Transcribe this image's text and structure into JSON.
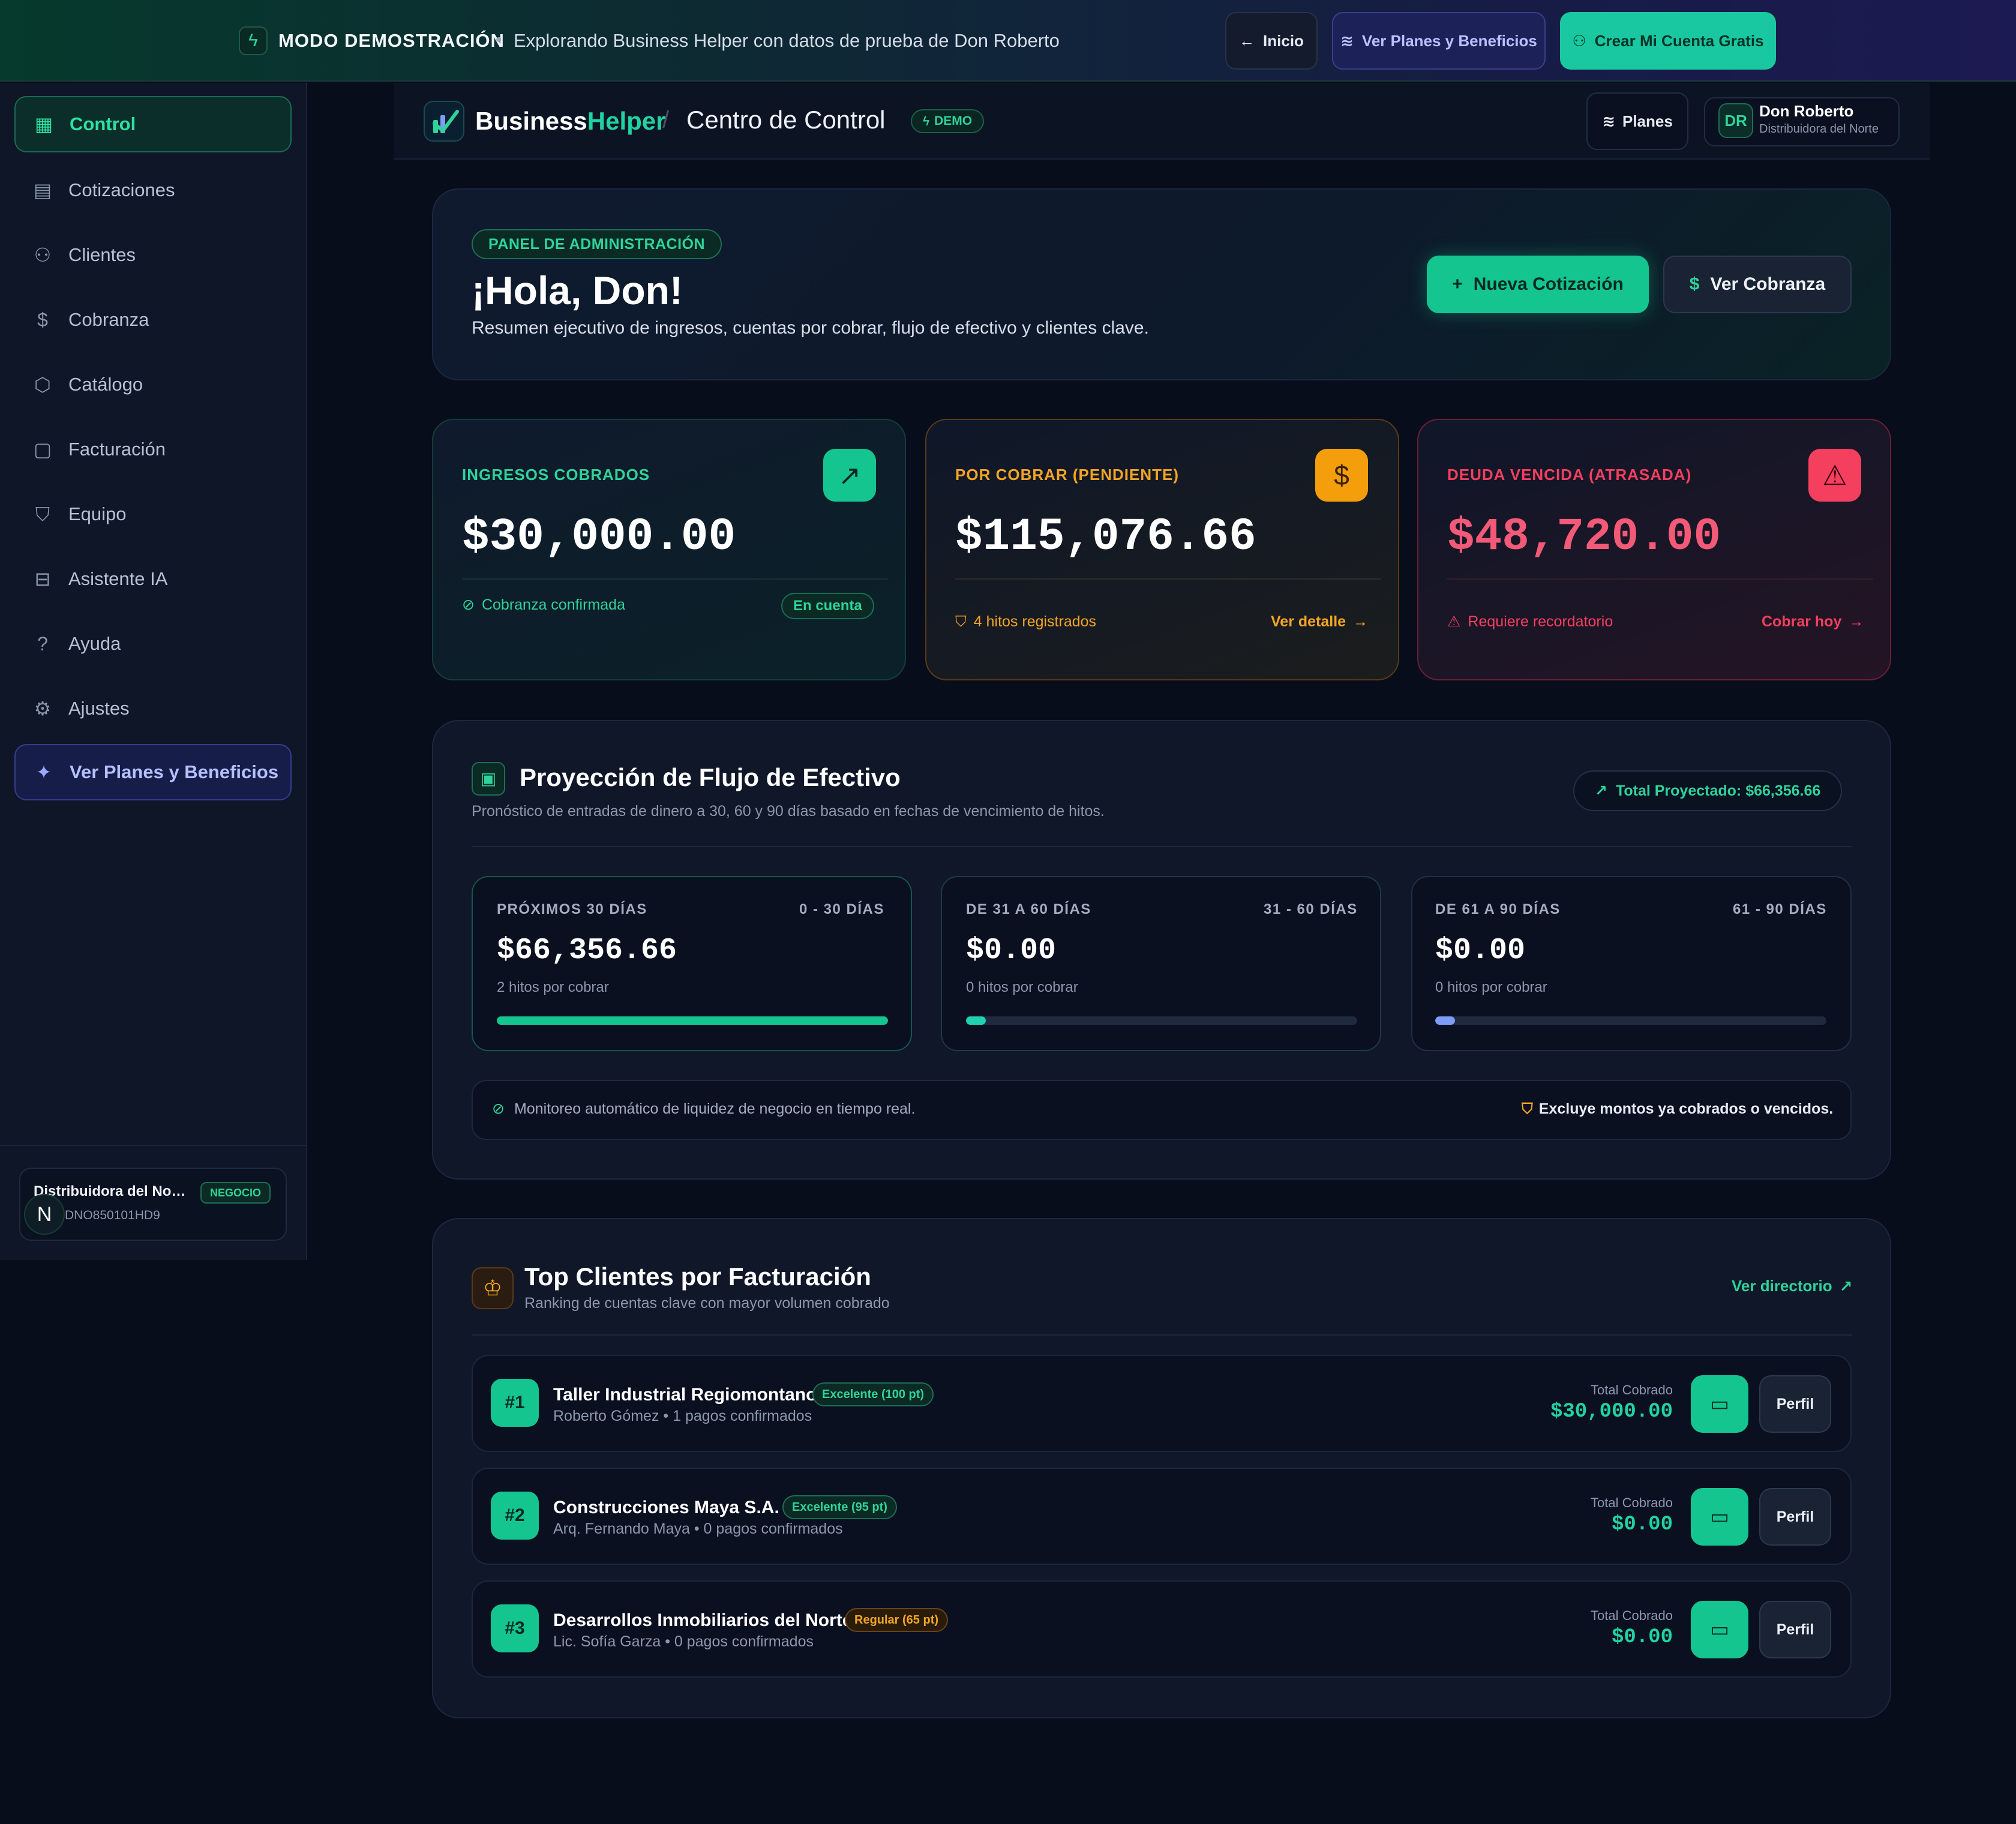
{
  "banner": {
    "title": "MODO DEMOSTRACIÓN",
    "dot": "•",
    "text": "Explorando Business Helper con datos de prueba de Don Roberto",
    "btn_inicio": "Inicio",
    "btn_planes": "Ver Planes y Beneficios",
    "btn_crear": "Crear Mi Cuenta Gratis"
  },
  "sidebar": {
    "items": [
      {
        "label": "Control",
        "icon": "grid-icon"
      },
      {
        "label": "Cotizaciones",
        "icon": "file-icon"
      },
      {
        "label": "Clientes",
        "icon": "users-icon"
      },
      {
        "label": "Cobranza",
        "icon": "dollar-icon"
      },
      {
        "label": "Catálogo",
        "icon": "box-icon"
      },
      {
        "label": "Facturación",
        "icon": "invoice-icon"
      },
      {
        "label": "Equipo",
        "icon": "shield-icon"
      },
      {
        "label": "Asistente IA",
        "icon": "bot-icon"
      },
      {
        "label": "Ayuda",
        "icon": "help-icon"
      },
      {
        "label": "Ajustes",
        "icon": "gear-icon"
      },
      {
        "label": "Ver Planes y Beneficios",
        "icon": "sparkles-icon"
      }
    ],
    "business": {
      "name": "Distribuidora del Norte",
      "badge": "NEGOCIO",
      "rfc": "DNO850101HD9",
      "avatar": "N"
    }
  },
  "header": {
    "brand_a": "Business",
    "brand_b": "Helper",
    "slash": "/",
    "title": "Centro de Control",
    "demo": "DEMO",
    "planes": "Planes",
    "user_initials": "DR",
    "user_name": "Don Roberto",
    "user_org": "Distribuidora del Norte"
  },
  "welcome": {
    "pill": "PANEL DE ADMINISTRACIÓN",
    "greeting": "¡Hola, Don!",
    "subtitle": "Resumen ejecutivo de ingresos, cuentas por cobrar, flujo de efectivo y clientes clave.",
    "btn_nueva": "Nueva Cotización",
    "btn_cobranza": "Ver Cobranza"
  },
  "kpis": [
    {
      "label": "INGRESOS COBRADOS",
      "value": "$30,000.00",
      "foot": "Cobranza confirmada",
      "action": "En cuenta",
      "color": "#2fd39a"
    },
    {
      "label": "POR COBRAR (PENDIENTE)",
      "value": "$115,076.66",
      "foot": "4 hitos registrados",
      "action": "Ver detalle",
      "color": "#f5a524"
    },
    {
      "label": "DEUDA VENCIDA (ATRASADA)",
      "value": "$48,720.00",
      "foot": "Requiere recordatorio",
      "action": "Cobrar hoy",
      "color": "#f43f5e"
    }
  ],
  "cashflow": {
    "title": "Proyección de Flujo de Efectivo",
    "subtitle": "Pronóstico de entradas de dinero a 30, 60 y 90 días basado en fechas de vencimiento de hitos.",
    "total": "Total Proyectado: $66,356.66",
    "buckets": [
      {
        "label": "PRÓXIMOS 30 DÍAS",
        "range": "0 - 30 DÍAS",
        "value": "$66,356.66",
        "sub": "2 hitos por cobrar",
        "fill": 1.0,
        "color": "#15c58f"
      },
      {
        "label": "DE 31 A 60 DÍAS",
        "range": "31 - 60 DÍAS",
        "value": "$0.00",
        "sub": "0 hitos por cobrar",
        "fill": 0.05,
        "color": "#1fd1b0"
      },
      {
        "label": "DE 61 A 90 DÍAS",
        "range": "61 - 90 DÍAS",
        "value": "$0.00",
        "sub": "0 hitos por cobrar",
        "fill": 0.05,
        "color": "#7c9cf5"
      }
    ],
    "note_left": "Monitoreo automático de liquidez de negocio en tiempo real.",
    "note_right": "Excluye montos ya cobrados o vencidos."
  },
  "top_clients": {
    "title": "Top Clientes por Facturación",
    "subtitle": "Ranking de cuentas clave con mayor volumen cobrado",
    "link": "Ver directorio",
    "total_label": "Total Cobrado",
    "perfil": "Perfil",
    "rows": [
      {
        "rank": "#1",
        "name": "Taller Industrial Regiomontano",
        "badge": "Excelente (100 pt)",
        "sub": "Roberto Gómez • 1 pagos confirmados",
        "amount": "$30,000.00",
        "tone": "green"
      },
      {
        "rank": "#2",
        "name": "Construcciones Maya S.A.",
        "badge": "Excelente (95 pt)",
        "sub": "Arq. Fernando Maya • 0 pagos confirmados",
        "amount": "$0.00",
        "tone": "green"
      },
      {
        "rank": "#3",
        "name": "Desarrollos Inmobiliarios del Norte",
        "badge": "Regular (65 pt)",
        "sub": "Lic. Sofía Garza • 0 pagos confirmados",
        "amount": "$0.00",
        "tone": "amber"
      }
    ]
  }
}
